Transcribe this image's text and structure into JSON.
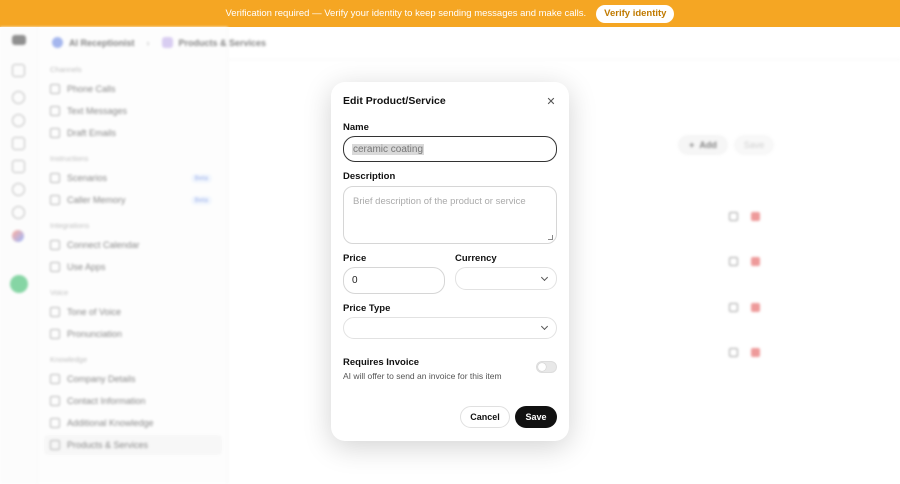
{
  "banner": {
    "message": "Verification required — Verify your identity to keep sending messages and make calls.",
    "button": "Verify identity"
  },
  "breadcrumb": {
    "root": "AI Receptionist",
    "current": "Products & Services"
  },
  "sidebar": {
    "sections": [
      {
        "title": "Channels",
        "items": [
          {
            "label": "Phone Calls"
          },
          {
            "label": "Text Messages"
          },
          {
            "label": "Draft Emails"
          }
        ]
      },
      {
        "title": "Instructions",
        "items": [
          {
            "label": "Scenarios",
            "badge": "Beta"
          },
          {
            "label": "Caller Memory",
            "badge": "Beta"
          }
        ]
      },
      {
        "title": "Integrations",
        "items": [
          {
            "label": "Connect Calendar"
          },
          {
            "label": "Use Apps"
          }
        ]
      },
      {
        "title": "Voice",
        "items": [
          {
            "label": "Tone of Voice"
          },
          {
            "label": "Pronunciation"
          }
        ]
      },
      {
        "title": "Knowledge",
        "items": [
          {
            "label": "Company Details"
          },
          {
            "label": "Contact Information"
          },
          {
            "label": "Additional Knowledge"
          },
          {
            "label": "Products & Services"
          }
        ]
      }
    ]
  },
  "main": {
    "add_label": "Add",
    "save_label": "Save"
  },
  "modal": {
    "title": "Edit Product/Service",
    "close_icon": "close-icon",
    "name_label": "Name",
    "name_value": "ceramic coating",
    "description_label": "Description",
    "description_placeholder": "Brief description of the product or service",
    "price_label": "Price",
    "price_value": "0",
    "currency_label": "Currency",
    "currency_value": "",
    "price_type_label": "Price Type",
    "price_type_value": "",
    "requires_invoice_label": "Requires Invoice",
    "requires_invoice_help": "AI will offer to send an invoice for this item",
    "requires_invoice_enabled": false,
    "cancel_label": "Cancel",
    "save_label": "Save"
  }
}
